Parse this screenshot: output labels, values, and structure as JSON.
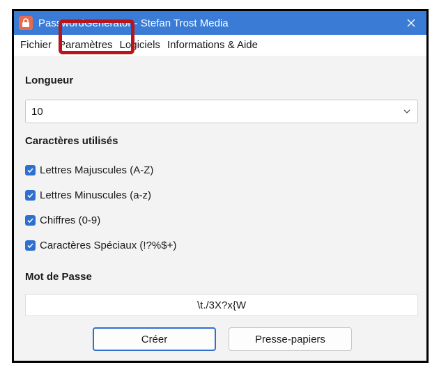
{
  "window": {
    "title": "PasswordGenerator - Stefan Trost Media"
  },
  "menu": {
    "items": [
      "Fichier",
      "Paramètres",
      "Logiciels",
      "Informations & Aide"
    ]
  },
  "length": {
    "label": "Longueur",
    "value": "10"
  },
  "characters": {
    "label": "Caractères utilisés",
    "options": [
      {
        "label": "Lettres Majuscules (A-Z)",
        "checked": true
      },
      {
        "label": "Lettres Minuscules (a-z)",
        "checked": true
      },
      {
        "label": "Chiffres (0-9)",
        "checked": true
      },
      {
        "label": "Caractères Spéciaux (!?%$+)",
        "checked": true
      }
    ]
  },
  "password": {
    "label": "Mot de Passe",
    "value": "\\t./3X?x{W"
  },
  "buttons": {
    "create": "Créer",
    "clipboard": "Presse-papiers"
  },
  "colors": {
    "titlebar": "#3a7bd5",
    "accent": "#2f6fd0",
    "highlight": "#b8141b",
    "app_icon": "#e66a4f"
  },
  "icons": {
    "app": "lock-icon",
    "close": "close-icon",
    "dropdown": "chevron-down-icon",
    "check": "checkmark-icon"
  }
}
